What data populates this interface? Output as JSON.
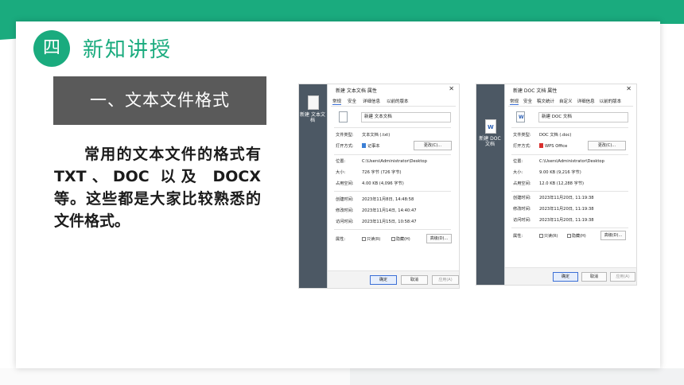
{
  "slide": {
    "badge": "四",
    "section_title": "新知讲授",
    "subtitle": "一、文本文件格式",
    "body": "常用的文本文件的格式有 TXT、DOC 以及 DOCX 等。这些都是大家比较熟悉的文件格式。"
  },
  "colors": {
    "accent": "#1aab7e",
    "subtitle_bg": "#5a5a5a"
  },
  "shot_txt": {
    "desktop_label": "新建 文本文档",
    "title": "新建 文本文档 属性",
    "close": "✕",
    "tabs": [
      "常规",
      "安全",
      "详细信息",
      "以前的版本"
    ],
    "file_name": "新建 文本文档",
    "type_key": "文件类型:",
    "type_val": "文本文档 (.txt)",
    "open_key": "打开方式:",
    "open_val": "记事本",
    "change_btn": "更改(C)...",
    "loc_key": "位置:",
    "loc_val": "C:\\Users\\Administrator\\Desktop",
    "size_key": "大小:",
    "size_val": "726 字节 (726 字节)",
    "disk_key": "占用空间:",
    "disk_val": "4.00 KB (4,096 字节)",
    "created_key": "创建时间:",
    "created_val": "2023年11月8日, 14:48:58",
    "modified_key": "修改时间:",
    "modified_val": "2023年11月14日, 14:40:47",
    "accessed_key": "访问时间:",
    "accessed_val": "2023年11月15日, 10:58:47",
    "attr_key": "属性:",
    "readonly": "只读(R)",
    "hidden": "隐藏(H)",
    "advanced_btn": "高级(D)...",
    "ok": "确定",
    "cancel": "取消",
    "apply": "应用(A)"
  },
  "shot_doc": {
    "desktop_label": "新建 DOC 文档",
    "title": "新建 DOC 文档 属性",
    "close": "✕",
    "tabs": [
      "常规",
      "安全",
      "稿文统计",
      "自定义",
      "详细信息",
      "以前的版本"
    ],
    "file_name": "新建 DOC 文档",
    "type_key": "文件类型:",
    "type_val": "DOC 文档 (.doc)",
    "open_key": "打开方式:",
    "open_val": "WPS Office",
    "change_btn": "更改(C)...",
    "loc_key": "位置:",
    "loc_val": "C:\\Users\\Administrator\\Desktop",
    "size_key": "大小:",
    "size_val": "9.00 KB (9,216 字节)",
    "disk_key": "占用空间:",
    "disk_val": "12.0 KB (12,288 字节)",
    "created_key": "创建时间:",
    "created_val": "2023年11月20日, 11:19:38",
    "modified_key": "修改时间:",
    "modified_val": "2023年11月20日, 11:19:38",
    "accessed_key": "访问时间:",
    "accessed_val": "2023年11月20日, 11:19:38",
    "attr_key": "属性:",
    "readonly": "只读(R)",
    "hidden": "隐藏(H)",
    "advanced_btn": "高级(D)...",
    "ok": "确定",
    "cancel": "取消",
    "apply": "应用(A)"
  }
}
